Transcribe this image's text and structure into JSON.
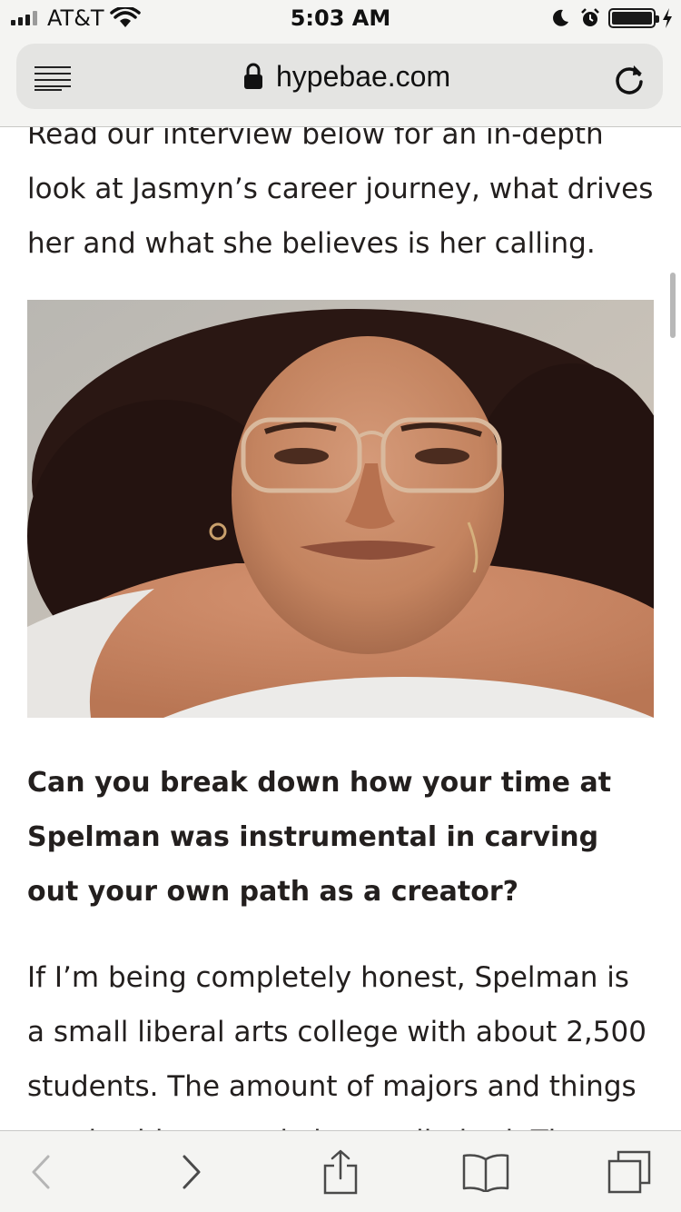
{
  "status_bar": {
    "carrier": "AT&T",
    "time": "5:03 AM",
    "signal_bars": 4,
    "signal_bars_active": 3,
    "icons": [
      "wifi-icon",
      "moon-icon",
      "alarm-icon",
      "battery-icon",
      "charging-bolt-icon"
    ]
  },
  "browser": {
    "domain": "hypebae.com",
    "icons": [
      "reader-view-icon",
      "lock-icon",
      "reload-icon"
    ]
  },
  "article": {
    "intro": "Read our interview below for an in-depth look at Jasmyn’s career journey, what drives her and what she believes is her calling.",
    "photo": {
      "icon": "portrait-photo"
    },
    "question": "Can you break down how your time at Spelman was instrumental in carving out your own path as a creator?",
    "answer": "If I’m being completely honest, Spelman is a small liberal arts college with about 2,500 students. The amount of majors and things one is able to study is very limited. The"
  },
  "toolbar": {
    "back_enabled": false,
    "icons": [
      "back-chevron-icon",
      "forward-chevron-icon",
      "share-icon",
      "bookmarks-icon",
      "tabs-icon"
    ]
  },
  "colors": {
    "text": "#231f1e",
    "chrome_bg": "#f4f4f2",
    "url_field_bg": "#e4e4e2",
    "toolbar_icon": "#4a4a4a",
    "disabled_icon": "#b5b5b5"
  }
}
